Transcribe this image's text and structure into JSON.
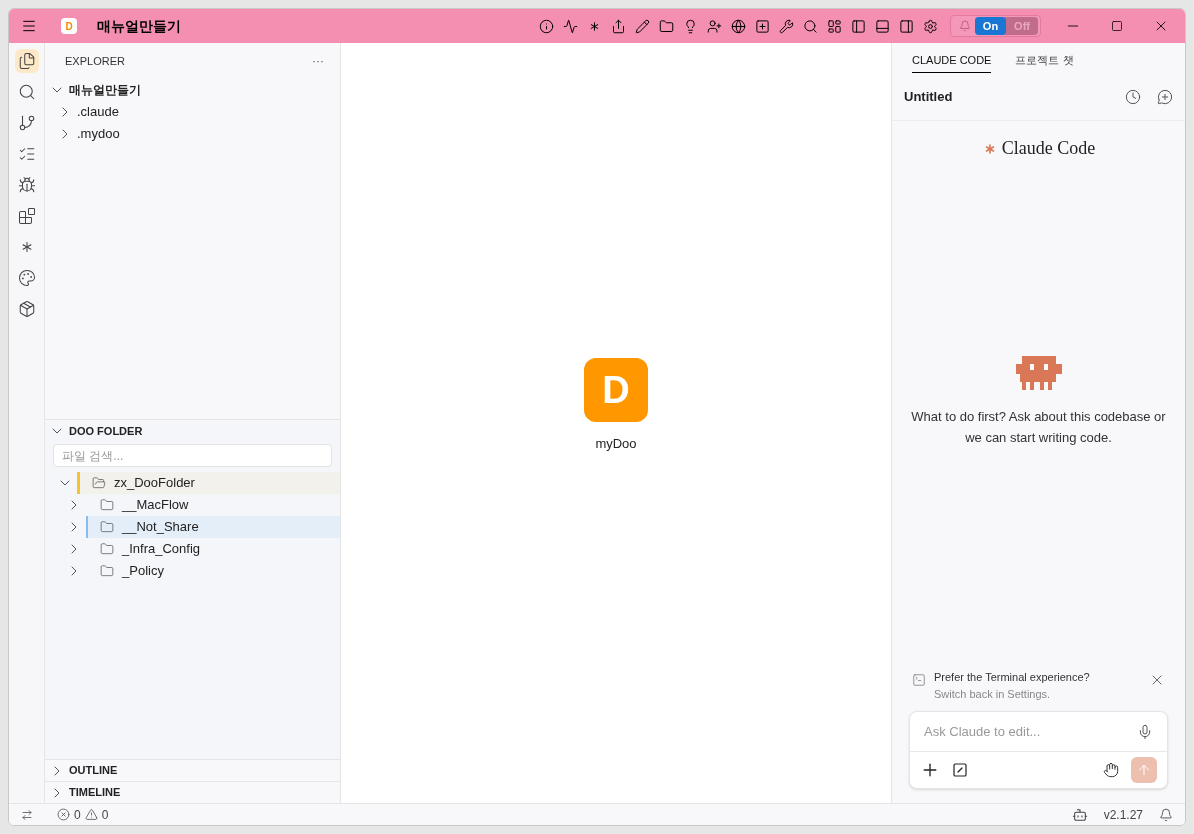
{
  "title_bar": {
    "logo_letter": "D",
    "title": "매뉴얼만들기",
    "toggle": [
      {
        "label": "On",
        "selected": true
      },
      {
        "label": "Off",
        "selected": false
      }
    ]
  },
  "activity_bar": [
    {
      "selected": true
    },
    {
      "selected": false
    },
    {
      "selected": false
    },
    {
      "selected": false
    },
    {
      "selected": false
    },
    {
      "selected": false
    },
    {
      "selected": false
    },
    {
      "selected": false
    },
    {
      "selected": false
    }
  ],
  "explorer": {
    "title": "EXPLORER",
    "more": "···",
    "root": {
      "label": "매뉴얼만들기",
      "expanded": true,
      "children": [
        {
          "label": ".claude",
          "expanded": false
        },
        {
          "label": ".mydoo",
          "expanded": false
        }
      ]
    }
  },
  "doo_folder": {
    "title": "DOO FOLDER",
    "expanded": true,
    "search": {
      "placeholder": "파일 검색..."
    },
    "tree": [
      {
        "label": "zx_DooFolder",
        "expanded": true,
        "active": true,
        "selected": false,
        "children": [
          {
            "label": "__MacFlow",
            "expanded": false,
            "active": false,
            "selected": false
          },
          {
            "label": "__Not_Share",
            "expanded": false,
            "active": false,
            "selected": true
          },
          {
            "label": "_Infra_Config",
            "expanded": false,
            "active": false,
            "selected": false
          },
          {
            "label": "_Policy",
            "expanded": false,
            "active": false,
            "selected": false
          }
        ]
      }
    ]
  },
  "sections": [
    {
      "title": "OUTLINE",
      "expanded": false
    },
    {
      "title": "TIMELINE",
      "expanded": false
    }
  ],
  "editor": {
    "logo_letter": "D",
    "label": "myDoo"
  },
  "claude_panel": {
    "tabs": [
      {
        "label": "CLAUDE CODE",
        "selected": true
      },
      {
        "label": "프로젝트 챗",
        "selected": false
      }
    ],
    "session_title": "Untitled",
    "brand": "Claude Code",
    "empty_message": "What to do first? Ask about this codebase or we can start writing code.",
    "notice": {
      "text": "Prefer the Terminal experience?",
      "link": "Switch back in Settings."
    },
    "input": {
      "placeholder": "Ask Claude to edit..."
    }
  },
  "status_bar": {
    "errors": "0",
    "warnings": "0",
    "version": "v2.1.27"
  }
}
